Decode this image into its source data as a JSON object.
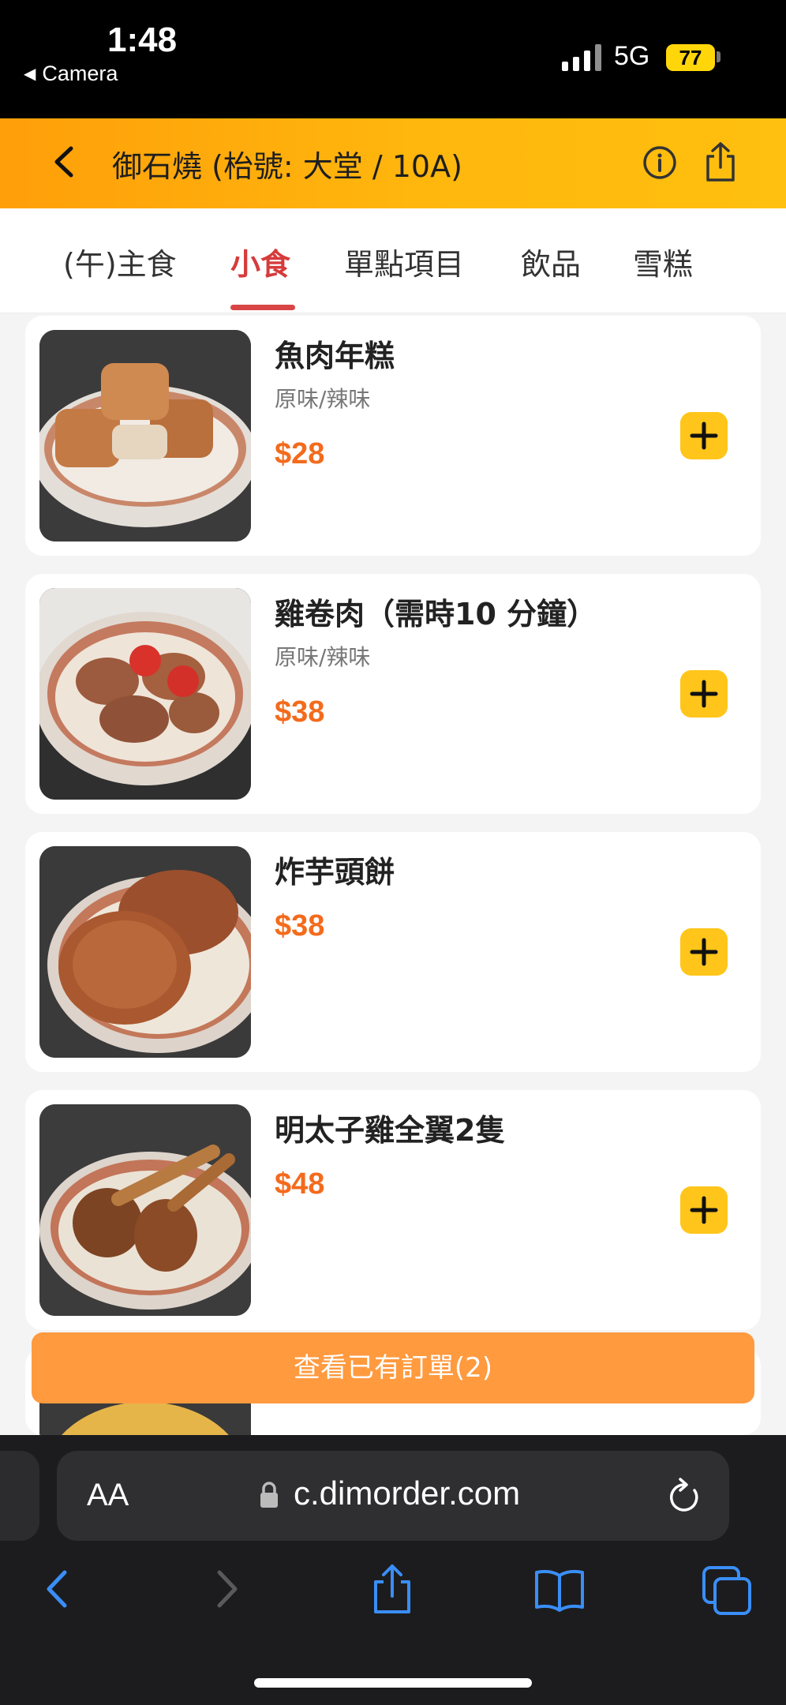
{
  "status_bar": {
    "time": "1:48",
    "back_label": "Camera",
    "network": "5G",
    "battery": "77"
  },
  "header": {
    "title": "御石燒 (枱號: 大堂 / 10A)"
  },
  "tabs": [
    {
      "label": "(午)主食"
    },
    {
      "label": "小食"
    },
    {
      "label": "單點項目"
    },
    {
      "label": "飲品"
    },
    {
      "label": "雪糕"
    }
  ],
  "active_tab": "小食",
  "items": [
    {
      "name": "魚肉年糕",
      "subtitle": "原味/辣味",
      "price": "$28"
    },
    {
      "name": "雞卷肉（需時10 分鐘）",
      "subtitle": "原味/辣味",
      "price": "$38"
    },
    {
      "name": "炸芋頭餅",
      "subtitle": "",
      "price": "$38"
    },
    {
      "name": "明太子雞全翼2隻",
      "subtitle": "",
      "price": "$48"
    }
  ],
  "view_orders_label": "查看已有訂單(2)",
  "browser": {
    "aa_label": "AA",
    "url": "c.dimorder.com"
  },
  "colors": {
    "header_accent": "#ffb70d",
    "price": "#f36b1c",
    "active_tab": "#d63b3b",
    "add_button": "#ffc51a",
    "orders_button": "#ff9a3f"
  }
}
